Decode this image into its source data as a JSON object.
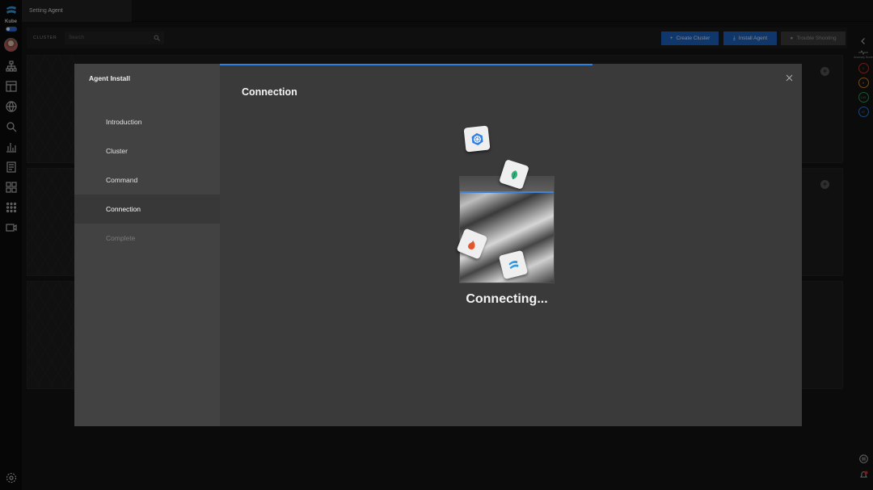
{
  "app": {
    "brand": "Kube"
  },
  "topbar": {
    "tab_prefix": "Setting",
    "tab_title": "Agent"
  },
  "toolbar": {
    "cluster_label": "CLUSTER",
    "search_placeholder": "Search",
    "create_cluster": "Create Cluster",
    "install_agent": "Install Agent",
    "trouble_shooting": "Trouble Shooting"
  },
  "right_rail": {
    "anomaly_label": "Anomaly Score",
    "counts": [
      {
        "value": "0",
        "color": "#c0392b"
      },
      {
        "value": "6",
        "color": "#d4862a"
      },
      {
        "value": "140",
        "color": "#2f9e5b"
      },
      {
        "value": "47",
        "color": "#2f80e0"
      }
    ]
  },
  "modal": {
    "title": "Agent Install",
    "heading": "Connection",
    "status": "Connecting...",
    "steps": [
      {
        "label": "Introduction",
        "state": "done"
      },
      {
        "label": "Cluster",
        "state": "done"
      },
      {
        "label": "Command",
        "state": "done"
      },
      {
        "label": "Connection",
        "state": "active"
      },
      {
        "label": "Complete",
        "state": "disabled"
      }
    ],
    "progress_fraction": 0.64
  },
  "colors": {
    "accent": "#1c64c4",
    "progress": "#2f80e0"
  }
}
